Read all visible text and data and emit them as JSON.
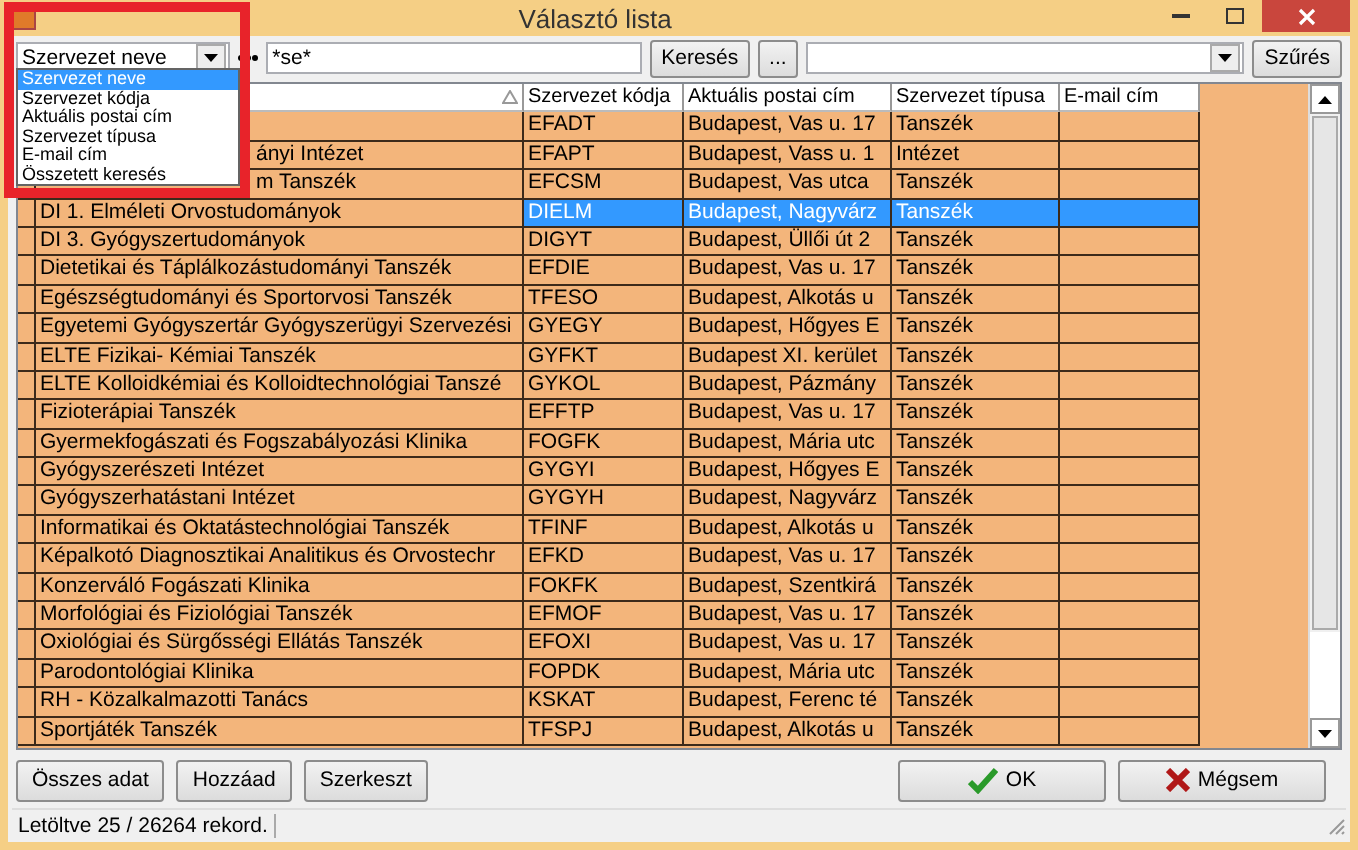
{
  "window": {
    "title": "Választó lista"
  },
  "toolbar": {
    "field_combo": {
      "value": "Szervezet neve",
      "expanded": true,
      "options": [
        {
          "label": "Szervezet neve",
          "selected": true
        },
        {
          "label": "Szervezet kódja",
          "selected": false
        },
        {
          "label": "Aktuális postai cím",
          "selected": false
        },
        {
          "label": "Szervezet típusa",
          "selected": false
        },
        {
          "label": "E-mail cím",
          "selected": false
        },
        {
          "label": "Összetett keresés",
          "selected": false
        }
      ]
    },
    "query": {
      "value": "*se*"
    },
    "search_button": "Keresés",
    "browse_button": "...",
    "filter_button": "Szűrés"
  },
  "table": {
    "columns": [
      {
        "sorted": true
      },
      {
        "label": "Szervezet kódja"
      },
      {
        "label": "Aktuális postai cím"
      },
      {
        "label": "Szervezet típusa"
      },
      {
        "label": "E-mail cím"
      }
    ],
    "rows": [
      {
        "code": "EFADT",
        "address": "Budapest, Vas u. 17",
        "type": "Tanszék",
        "selected": false
      },
      {
        "name_tail": "ányi Intézet",
        "code": "EFAPT",
        "address": "Budapest, Vass u. 1",
        "type": "Intézet",
        "selected": false
      },
      {
        "name_tail": "m Tanszék",
        "code": "EFCSM",
        "address": "Budapest, Vas utca",
        "type": "Tanszék",
        "selected": false
      },
      {
        "name": "DI 1. Elméleti Orvostudományok",
        "code": "DIELM",
        "address": "Budapest, Nagyvárz",
        "type": "Tanszék",
        "selected": true
      },
      {
        "name": "DI 3. Gyógyszertudományok",
        "code": "DIGYT",
        "address": "Budapest, Üllői út 2",
        "type": "Tanszék",
        "selected": false
      },
      {
        "name": "Dietetikai és Táplálkozástudományi Tanszék",
        "code": "EFDIE",
        "address": "Budapest, Vas u. 17",
        "type": "Tanszék",
        "selected": false
      },
      {
        "name": "Egészségtudományi és Sportorvosi Tanszék",
        "code": "TFESO",
        "address": "Budapest, Alkotás u",
        "type": "Tanszék",
        "selected": false
      },
      {
        "name": "Egyetemi Gyógyszertár Gyógyszerügyi Szervezési",
        "code": "GYEGY",
        "address": "Budapest, Hőgyes E",
        "type": "Tanszék",
        "selected": false
      },
      {
        "name": "ELTE Fizikai- Kémiai Tanszék",
        "code": "GYFKT",
        "address": "Budapest XI. kerület",
        "type": "Tanszék",
        "selected": false
      },
      {
        "name": "ELTE Kolloidkémiai és Kolloidtechnológiai Tanszé",
        "code": "GYKOL",
        "address": "Budapest, Pázmány",
        "type": "Tanszék",
        "selected": false
      },
      {
        "name": "Fizioterápiai Tanszék",
        "code": "EFFTP",
        "address": "Budapest, Vas u. 17",
        "type": "Tanszék",
        "selected": false
      },
      {
        "name": "Gyermekfogászati és Fogszabályozási Klinika",
        "code": "FOGFK",
        "address": "Budapest, Mária utc",
        "type": "Tanszék",
        "selected": false
      },
      {
        "name": "Gyógyszerészeti Intézet",
        "code": "GYGYI",
        "address": "Budapest, Hőgyes E",
        "type": "Tanszék",
        "selected": false
      },
      {
        "name": "Gyógyszerhatástani Intézet",
        "code": "GYGYH",
        "address": "Budapest, Nagyvárz",
        "type": "Tanszék",
        "selected": false
      },
      {
        "name": "Informatikai és Oktatástechnológiai Tanszék",
        "code": "TFINF",
        "address": "Budapest, Alkotás u",
        "type": "Tanszék",
        "selected": false
      },
      {
        "name": "Képalkotó Diagnosztikai Analitikus és Orvostechr",
        "code": "EFKD",
        "address": "Budapest, Vas u. 17",
        "type": "Tanszék",
        "selected": false
      },
      {
        "name": "Konzerváló Fogászati Klinika",
        "code": "FOKFK",
        "address": "Budapest, Szentkirá",
        "type": "Tanszék",
        "selected": false
      },
      {
        "name": "Morfológiai és Fiziológiai Tanszék",
        "code": "EFMOF",
        "address": "Budapest, Vas u. 17",
        "type": "Tanszék",
        "selected": false
      },
      {
        "name": "Oxiológiai és Sürgősségi Ellátás Tanszék",
        "code": "EFOXI",
        "address": "Budapest, Vas u. 17",
        "type": "Tanszék",
        "selected": false
      },
      {
        "name": "Parodontológiai Klinika",
        "code": "FOPDK",
        "address": "Budapest, Mária utc",
        "type": "Tanszék",
        "selected": false
      },
      {
        "name": "RH - Közalkalmazotti Tanács",
        "code": "KSKAT",
        "address": "Budapest, Ferenc té",
        "type": "Tanszék",
        "selected": false
      },
      {
        "name": "Sportjáték Tanszék",
        "code": "TFSPJ",
        "address": "Budapest, Alkotás u",
        "type": "Tanszék",
        "selected": false
      }
    ]
  },
  "buttons_left": [
    "Összes adat",
    "Hozzáad",
    "Szerkeszt"
  ],
  "buttons_right": [
    {
      "kind": "ok",
      "label": "OK"
    },
    {
      "kind": "cancel",
      "label": "Mégsem"
    }
  ],
  "status_bar": {
    "text": "Letöltve 25 / 26264 rekord."
  }
}
